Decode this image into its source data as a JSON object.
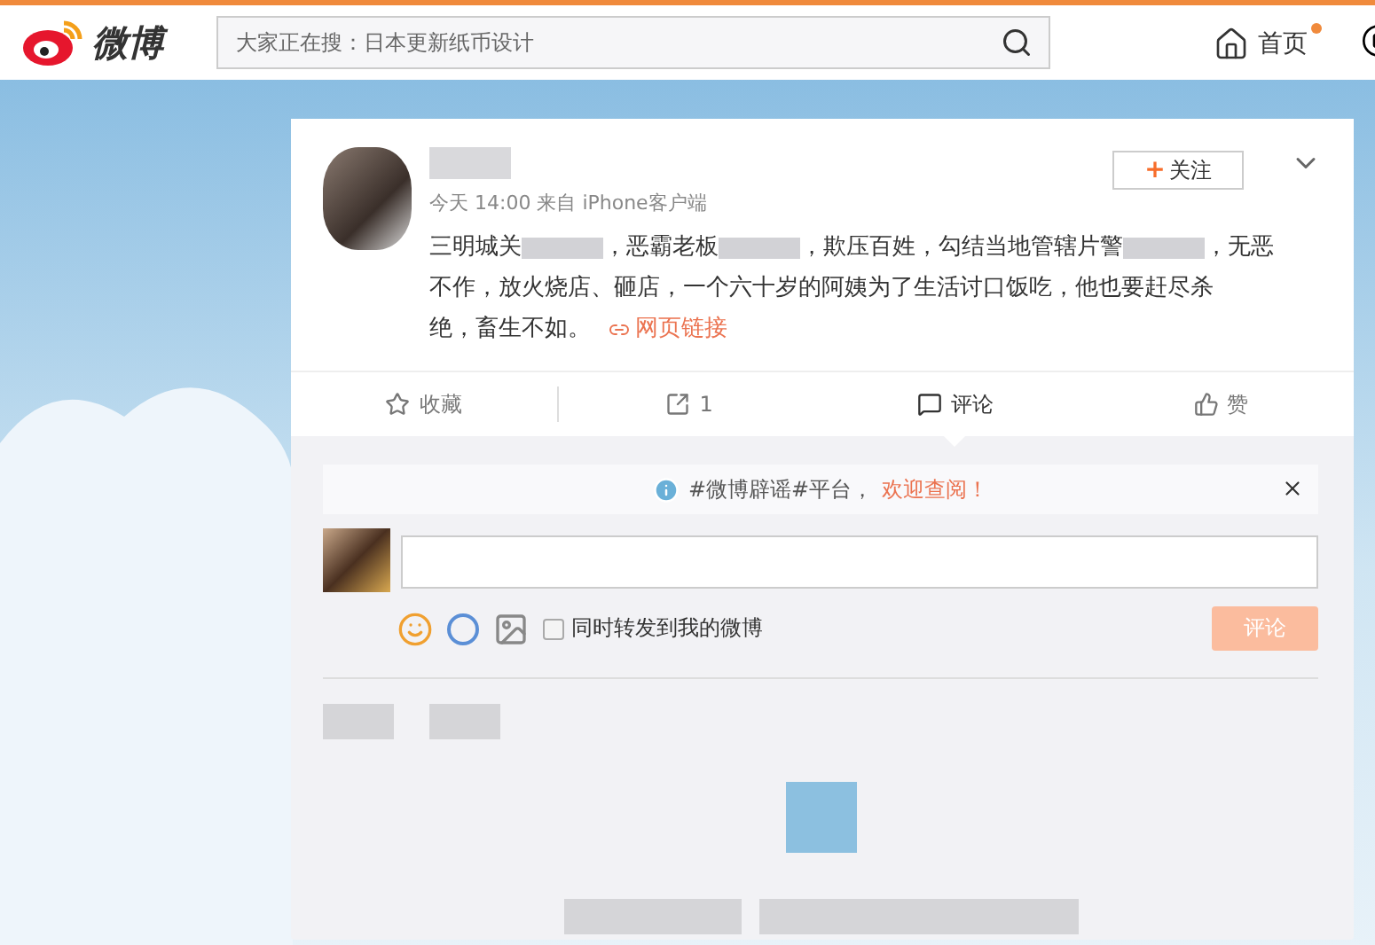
{
  "topbar": {
    "logo_text": "微博",
    "search": {
      "placeholder": "大家正在搜：日本更新纸币设计"
    },
    "nav": [
      {
        "label": "首页",
        "badge": true
      }
    ]
  },
  "post": {
    "meta": "今天 14:00 来自 iPhone客户端",
    "follow_label": "关注",
    "follow_plus": "+",
    "lines": [
      [
        {
          "kind": "text",
          "text": "三明城关"
        },
        {
          "kind": "redacted"
        },
        {
          "kind": "text",
          "text": "，恶霸老板"
        },
        {
          "kind": "redacted"
        },
        {
          "kind": "text",
          "text": "，欺压百姓，勾结当地管辖片警"
        },
        {
          "kind": "redacted"
        },
        {
          "kind": "text",
          "text": "，无恶"
        }
      ],
      [
        {
          "kind": "text",
          "text": "不作，放火烧店、砸店，一个六十岁的阿姨为了生活讨口饭吃，他也要赶尽杀"
        }
      ],
      [
        {
          "kind": "text",
          "text": "绝，畜生不如。"
        }
      ]
    ],
    "link": "网页链接"
  },
  "actions": [
    {
      "label": "收藏",
      "selected": false
    },
    {
      "label": "1",
      "selected": false
    },
    {
      "label": "评论",
      "selected": true
    },
    {
      "label": "赞",
      "selected": false
    }
  ],
  "notice": {
    "text": "#微博辟谣#平台，",
    "highlight": "欢迎查阅！"
  },
  "composer": {
    "repost_label": "同时转发到我的微博",
    "repost_checked": false,
    "submit": "评论"
  }
}
